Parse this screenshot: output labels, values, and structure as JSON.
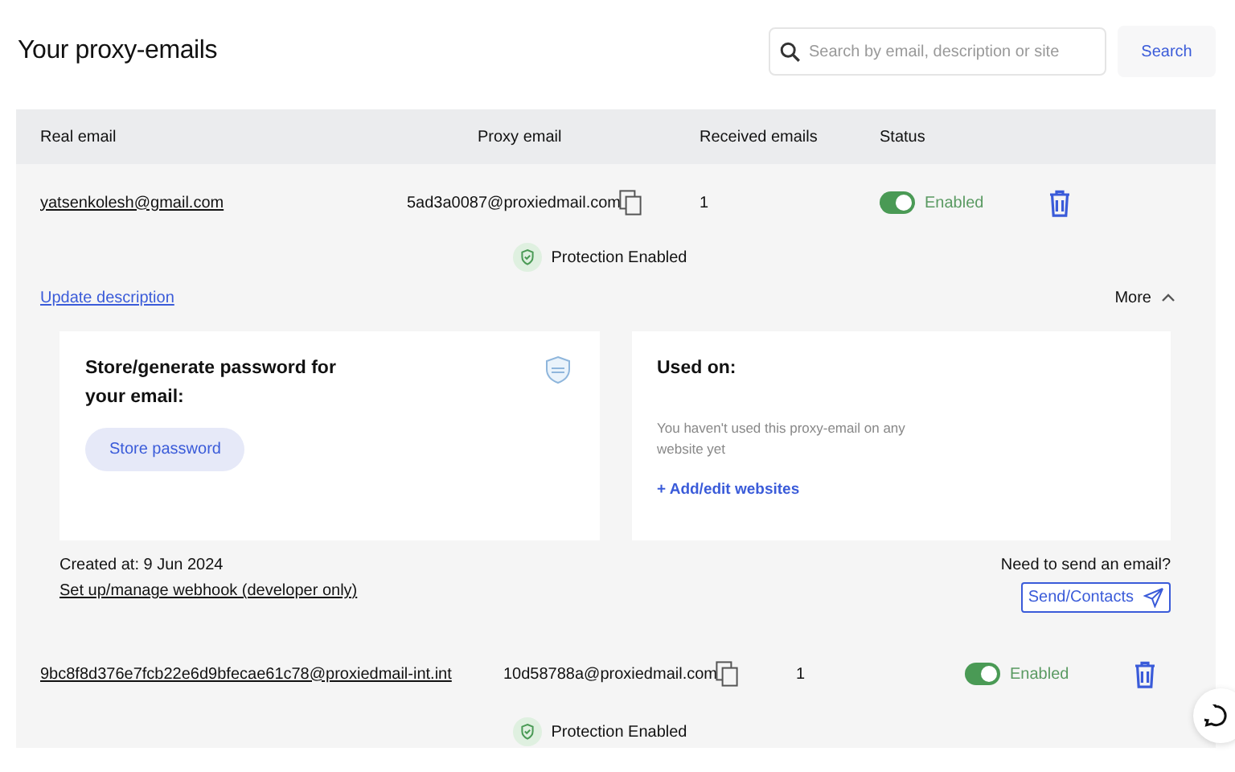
{
  "title": "Your proxy-emails",
  "search": {
    "placeholder": "Search by email, description or site",
    "button": "Search"
  },
  "columns": [
    "Real email",
    "Proxy email",
    "Received emails",
    "Status"
  ],
  "rows": [
    {
      "real_email": "yatsenkolesh@gmail.com",
      "proxy_email": "5ad3a0087@proxiedmail.com",
      "received": "1",
      "enabled": true,
      "status": "Enabled",
      "protection": "Protection Enabled",
      "details": {
        "update_link": "Update description",
        "more": "More",
        "password_title": "Store/generate password for your email:",
        "store_button": "Store password",
        "used_title": "Used on:",
        "used_note": "You haven't used this proxy-email on any website yet",
        "add_link": "+ Add/edit websites",
        "created": "Created at: 9 Jun 2024",
        "webhook_link": "Set up/manage webhook (developer only)",
        "send_question": "Need to send an email?",
        "send_button": "Send/Contacts"
      }
    },
    {
      "real_email": "9bc8f8d376e7fcb22e6d9bfecae61c78@proxiedmail-int.int",
      "proxy_email": "10d58788a@proxiedmail.com",
      "received": "1",
      "enabled": true,
      "status": "Enabled",
      "protection": "Protection Enabled"
    }
  ]
}
